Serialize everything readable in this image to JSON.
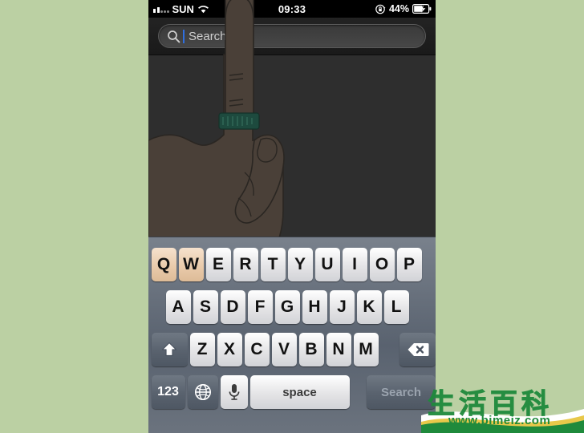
{
  "background_color": "#bbd0a3",
  "phone": {
    "screen_background": "#2e2e2e",
    "status_bar": {
      "carrier": "SUN",
      "wifi_icon": "wifi-icon",
      "signal_icon": "signal-strength-icon",
      "time": "09:33",
      "rotation_lock_icon": "rotation-lock-icon",
      "battery_percent": "44%",
      "battery_icon": "battery-charging-icon"
    },
    "search_bar": {
      "search_icon": "search-icon",
      "placeholder": "Search",
      "value": "",
      "cursor_visible": true,
      "cursor_color": "#2f6fe0"
    },
    "content_area": {
      "illustration": "hand-pointing-index-finger",
      "ring_color": "#1d4a3e"
    },
    "keyboard": {
      "row1": [
        "Q",
        "W",
        "E",
        "R",
        "T",
        "Y",
        "U",
        "I",
        "O",
        "P"
      ],
      "row1_highlighted": [
        "Q",
        "W"
      ],
      "row2": [
        "A",
        "S",
        "D",
        "F",
        "G",
        "H",
        "J",
        "K",
        "L"
      ],
      "row3": [
        "Z",
        "X",
        "C",
        "V",
        "B",
        "N",
        "M"
      ],
      "shift_icon": "shift-arrow-icon",
      "delete_icon": "backspace-delete-icon",
      "numbers_label": "123",
      "globe_icon": "globe-language-icon",
      "mic_icon": "microphone-icon",
      "space_label": "space",
      "search_label": "Search"
    }
  },
  "watermark": {
    "characters": "生活百科",
    "url": "www.bimeiz.com",
    "color": "#1f8a3c"
  }
}
